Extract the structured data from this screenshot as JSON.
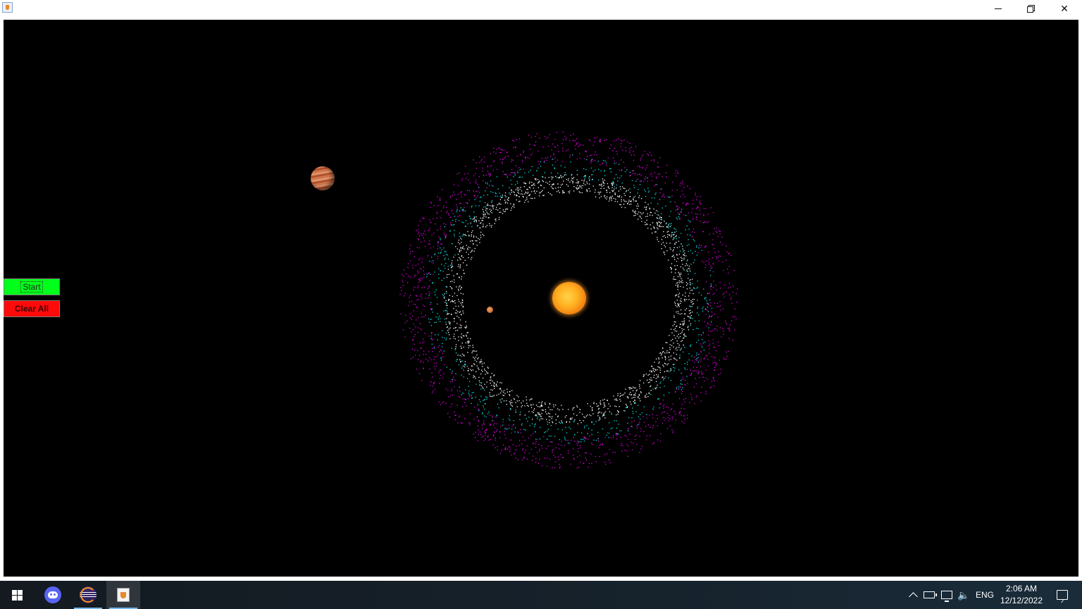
{
  "window": {
    "title": "",
    "controls": {
      "minimize_icon": "minimize-icon",
      "maximize_icon": "restore-icon",
      "close_label": "✕"
    }
  },
  "canvas": {
    "background": "#000000",
    "buttons": {
      "start_label": "Start",
      "start_color": "#00ff1a",
      "clear_label": "Clear All",
      "clear_color": "#ff0a0a"
    },
    "bodies": {
      "sun": "sun-icon",
      "jupiter": "jupiter-icon",
      "mars": "mars-icon"
    },
    "belt_colors": {
      "inner": "#ffffff",
      "middle": "#00e5e5",
      "outer": "#e000e0"
    }
  },
  "taskbar": {
    "apps": [
      "windows-start-icon",
      "discord-icon",
      "eclipse-icon",
      "java-app-icon"
    ],
    "tray": {
      "volume_glyph": "🔈",
      "language": "ENG",
      "time": "2:06 AM",
      "date": "12/12/2022"
    }
  }
}
